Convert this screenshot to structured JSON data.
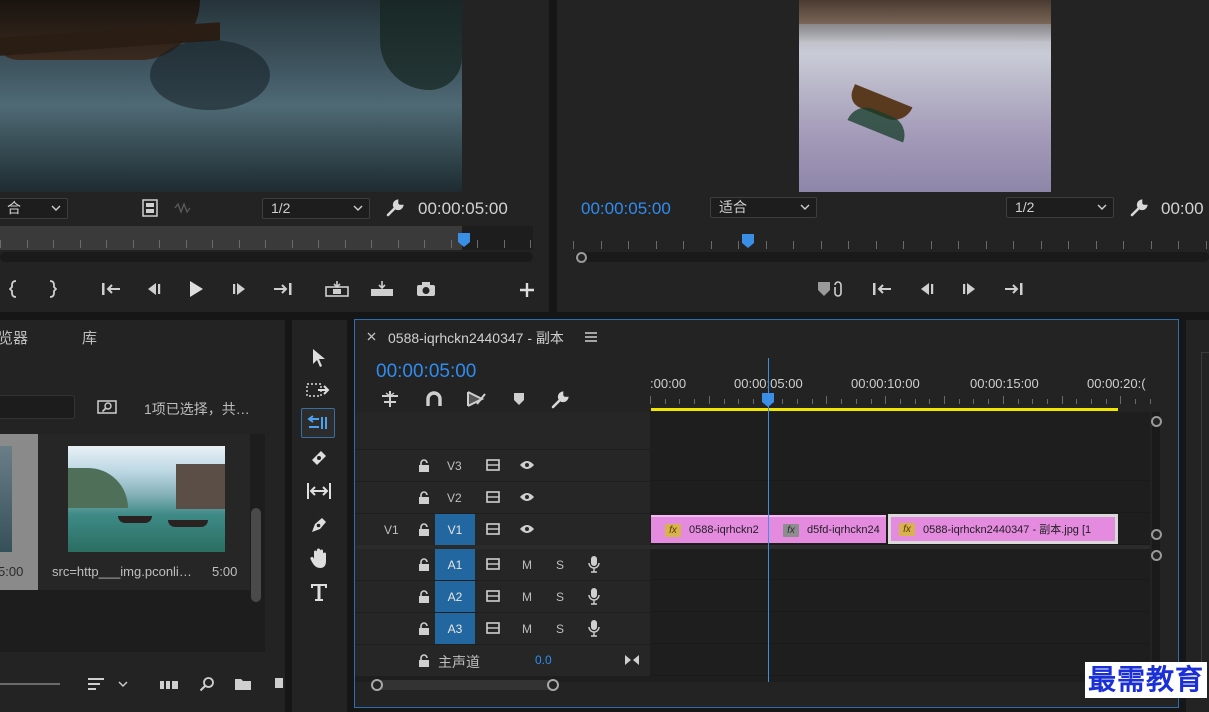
{
  "source_monitor": {
    "fit_label": "合",
    "resolution": "1/2",
    "timecode": "00:00:05:00"
  },
  "program_monitor": {
    "timecode_current": "00:00:05:00",
    "fit_label": "适合",
    "resolution": "1/2",
    "timecode_duration": "00:00"
  },
  "project_panel": {
    "tabs": [
      "览器",
      "库"
    ],
    "selection_status": "1项已选择，共…",
    "items": [
      {
        "name": "",
        "duration": "5:00"
      },
      {
        "name": "src=http___img.pconli…",
        "duration": "5:00"
      }
    ]
  },
  "timeline": {
    "sequence_name": "0588-iqrhckn2440347 - 副本",
    "playhead_timecode": "00:00:05:00",
    "ruler_labels": [
      ":00:00",
      "00:00:05:00",
      "00:00:10:00",
      "00:00:15:00",
      "00:00:20:("
    ],
    "video_tracks": [
      {
        "source": "",
        "name": "V3"
      },
      {
        "source": "",
        "name": "V2"
      },
      {
        "source": "V1",
        "name": "V1"
      }
    ],
    "audio_tracks": [
      {
        "name": "A1",
        "m": "M",
        "s": "S"
      },
      {
        "name": "A2",
        "m": "M",
        "s": "S"
      },
      {
        "name": "A3",
        "m": "M",
        "s": "S"
      }
    ],
    "master": {
      "label": "主声道",
      "value": "0.0"
    },
    "clips": [
      {
        "fx": "fx",
        "name": "0588-iqrhckn2"
      },
      {
        "fx": "fx",
        "name": "d5fd-iqrhckn24"
      },
      {
        "fx": "fx",
        "name": "0588-iqrhckn2440347 - 副本.jpg [1"
      }
    ]
  },
  "watermark": "最需教育",
  "colors": {
    "accent_blue": "#2f8cf0",
    "clip_pink": "#e48be0",
    "work_area_yellow": "#f2e600",
    "track_target_blue": "#2367a0"
  }
}
